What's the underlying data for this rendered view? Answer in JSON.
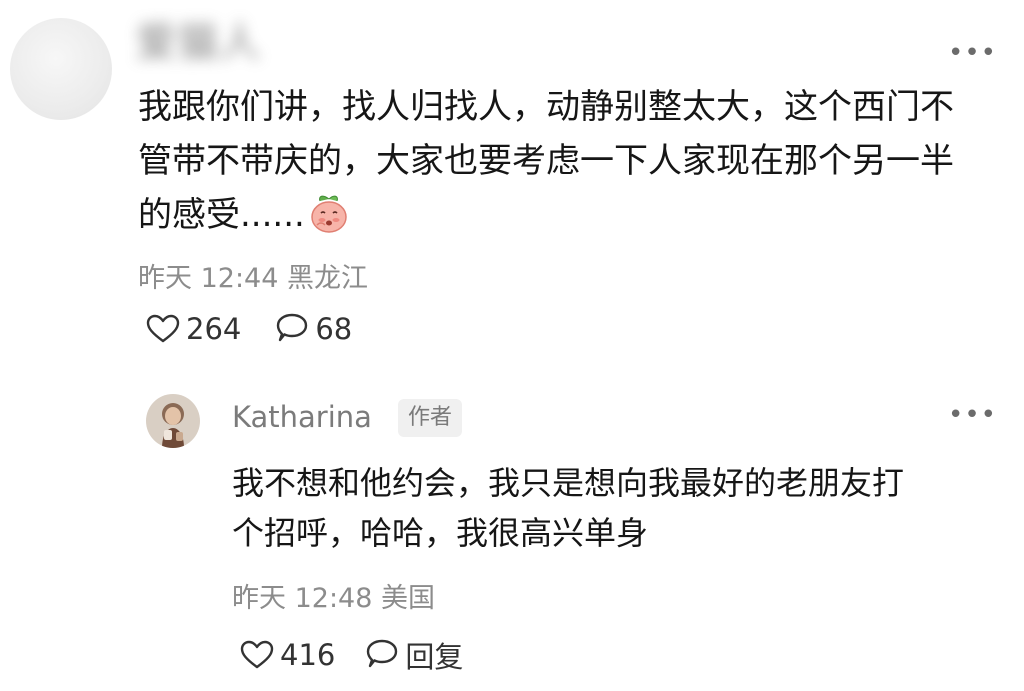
{
  "comment": {
    "author_name": "爱猫人",
    "more_icon": "more-dots-icon",
    "text_lines": [
      "我跟你们讲，找人归找人，动静别整太大，这个西门不",
      "管带不带庆的，大家也要考虑一下人家现在那个另一半",
      "的感受......"
    ],
    "emoji": "peach-emoji",
    "time": "昨天 12:44",
    "location": "黑龙江",
    "likes": "264",
    "replies": "68"
  },
  "reply": {
    "author_name": "Katharina",
    "badge": "作者",
    "more_icon": "more-dots-icon",
    "text_lines": [
      "我不想和他约会，我只是想向我最好的老朋友打",
      "个招呼，哈哈，我很高兴单身"
    ],
    "time": "昨天 12:48",
    "location": "美国",
    "likes": "416",
    "reply_label": "回复"
  },
  "colors": {
    "text_primary": "#161616",
    "text_meta": "#8c8c8c",
    "badge_bg": "#f0f0f0"
  }
}
